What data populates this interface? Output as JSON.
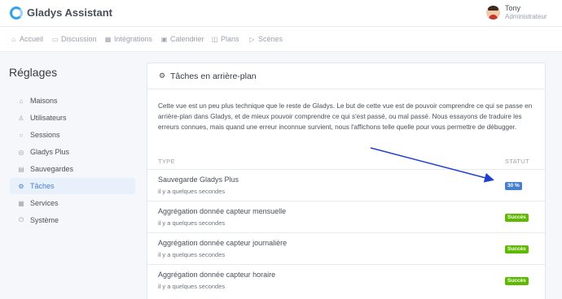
{
  "header": {
    "app_title": "Gladys Assistant",
    "user_name": "Tony",
    "user_role": "Administrateur"
  },
  "nav": [
    {
      "label": "Accueil",
      "icon": "home-icon"
    },
    {
      "label": "Discussion",
      "icon": "message-icon"
    },
    {
      "label": "Intégrations",
      "icon": "grid-icon"
    },
    {
      "label": "Calendrier",
      "icon": "calendar-icon"
    },
    {
      "label": "Plans",
      "icon": "map-icon"
    },
    {
      "label": "Scènes",
      "icon": "play-icon"
    }
  ],
  "page_title": "Réglages",
  "sidebar": [
    {
      "label": "Maisons",
      "icon": "home-icon"
    },
    {
      "label": "Utilisateurs",
      "icon": "user-icon"
    },
    {
      "label": "Sessions",
      "icon": "circle-icon"
    },
    {
      "label": "Gladys Plus",
      "icon": "globe-icon"
    },
    {
      "label": "Sauvegardes",
      "icon": "database-icon"
    },
    {
      "label": "Tâches",
      "icon": "cog-icon",
      "active": true
    },
    {
      "label": "Services",
      "icon": "grid-icon"
    },
    {
      "label": "Système",
      "icon": "power-icon"
    }
  ],
  "card": {
    "title": "Tâches en arrière-plan",
    "description": "Cette vue est un peu plus technique que le reste de Gladys. Le but de cette vue est de pouvoir comprendre ce qui se passe en arrière-plan dans Gladys, et de mieux pouvoir comprendre ce qui s'est passé, ou mal passé. Nous essayons de traduire les erreurs connues, mais quand une erreur inconnue survient, nous l'affichons telle quelle pour vous permettre de débugger.",
    "col_type": "TYPE",
    "col_status": "STATUT",
    "rows": [
      {
        "name": "Sauvegarde Gladys Plus",
        "time": "il y a quelques secondes",
        "status": "30 %",
        "status_color": "#467fcf"
      },
      {
        "name": "Aggrégation donnée capteur mensuelle",
        "time": "il y a quelques secondes",
        "status": "Succès",
        "status_color": "#5eba00"
      },
      {
        "name": "Aggrégation donnée capteur journalière",
        "time": "il y a quelques secondes",
        "status": "Succès",
        "status_color": "#5eba00"
      },
      {
        "name": "Aggrégation donnée capteur horaire",
        "time": "il y a quelques secondes",
        "status": "Succès",
        "status_color": "#5eba00"
      }
    ]
  },
  "annotation": {
    "color": "#1f3fd1"
  }
}
